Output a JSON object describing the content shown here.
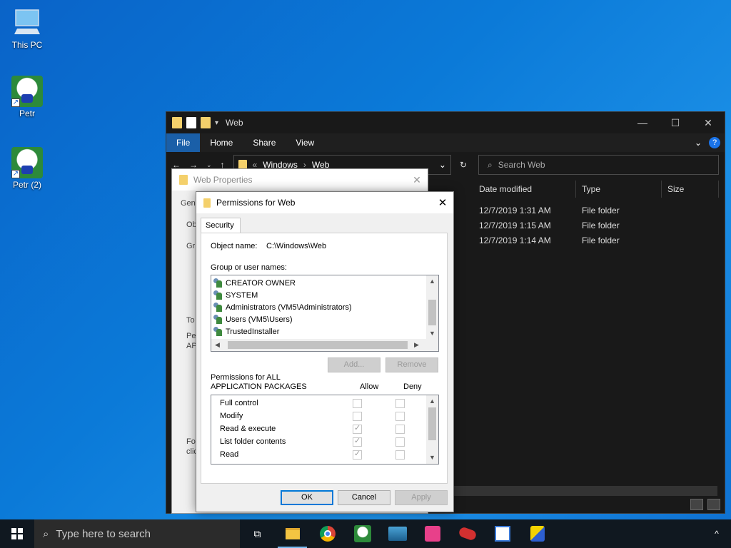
{
  "desktop": {
    "icons": [
      {
        "label": "This PC"
      },
      {
        "label": "Petr"
      },
      {
        "label": "Petr (2)"
      }
    ]
  },
  "explorer": {
    "title": "Web",
    "ribbon_tabs": [
      "File",
      "Home",
      "Share",
      "View"
    ],
    "address": {
      "prefix": "«",
      "parts": [
        "Windows",
        "Web"
      ]
    },
    "search_placeholder": "Search Web",
    "columns": [
      "Date modified",
      "Type",
      "Size"
    ],
    "rows": [
      {
        "date": "12/7/2019 1:31 AM",
        "type": "File folder"
      },
      {
        "date": "12/7/2019 1:15 AM",
        "type": "File folder"
      },
      {
        "date": "12/7/2019 1:14 AM",
        "type": "File folder"
      }
    ]
  },
  "properties": {
    "title": "Web Properties",
    "fragments": [
      "Gen",
      "Ob",
      "Gr",
      "To",
      "Pe",
      "AP",
      "Fo",
      "clic"
    ]
  },
  "permissions": {
    "title": "Permissions for Web",
    "tab": "Security",
    "object_name_label": "Object name:",
    "object_name_value": "C:\\Windows\\Web",
    "group_label": "Group or user names:",
    "users": [
      "CREATOR OWNER",
      "SYSTEM",
      "Administrators (VM5\\Administrators)",
      "Users (VM5\\Users)",
      "TrustedInstaller"
    ],
    "add_button": "Add...",
    "remove_button": "Remove",
    "perm_label_line1": "Permissions for ALL",
    "perm_label_line2": "APPLICATION PACKAGES",
    "allow_label": "Allow",
    "deny_label": "Deny",
    "permissions_list": [
      {
        "name": "Full control",
        "allow": false,
        "deny": false
      },
      {
        "name": "Modify",
        "allow": false,
        "deny": false
      },
      {
        "name": "Read & execute",
        "allow": true,
        "deny": false
      },
      {
        "name": "List folder contents",
        "allow": true,
        "deny": false
      },
      {
        "name": "Read",
        "allow": true,
        "deny": false
      }
    ],
    "ok_button": "OK",
    "cancel_button": "Cancel",
    "apply_button": "Apply"
  },
  "taskbar": {
    "search_placeholder": "Type here to search",
    "apps": [
      "task-view-icon",
      "file-explorer-icon",
      "chrome-icon",
      "petr-app-icon",
      "shark-app-icon",
      "puzzle-app-icon",
      "red-app-icon",
      "clock-app-icon",
      "paint-app-icon"
    ],
    "tray_chevron": "^"
  },
  "colors": {
    "accent": "#0078d7",
    "explorer_bg": "#191919",
    "file_tab": "#1a5fa8"
  }
}
